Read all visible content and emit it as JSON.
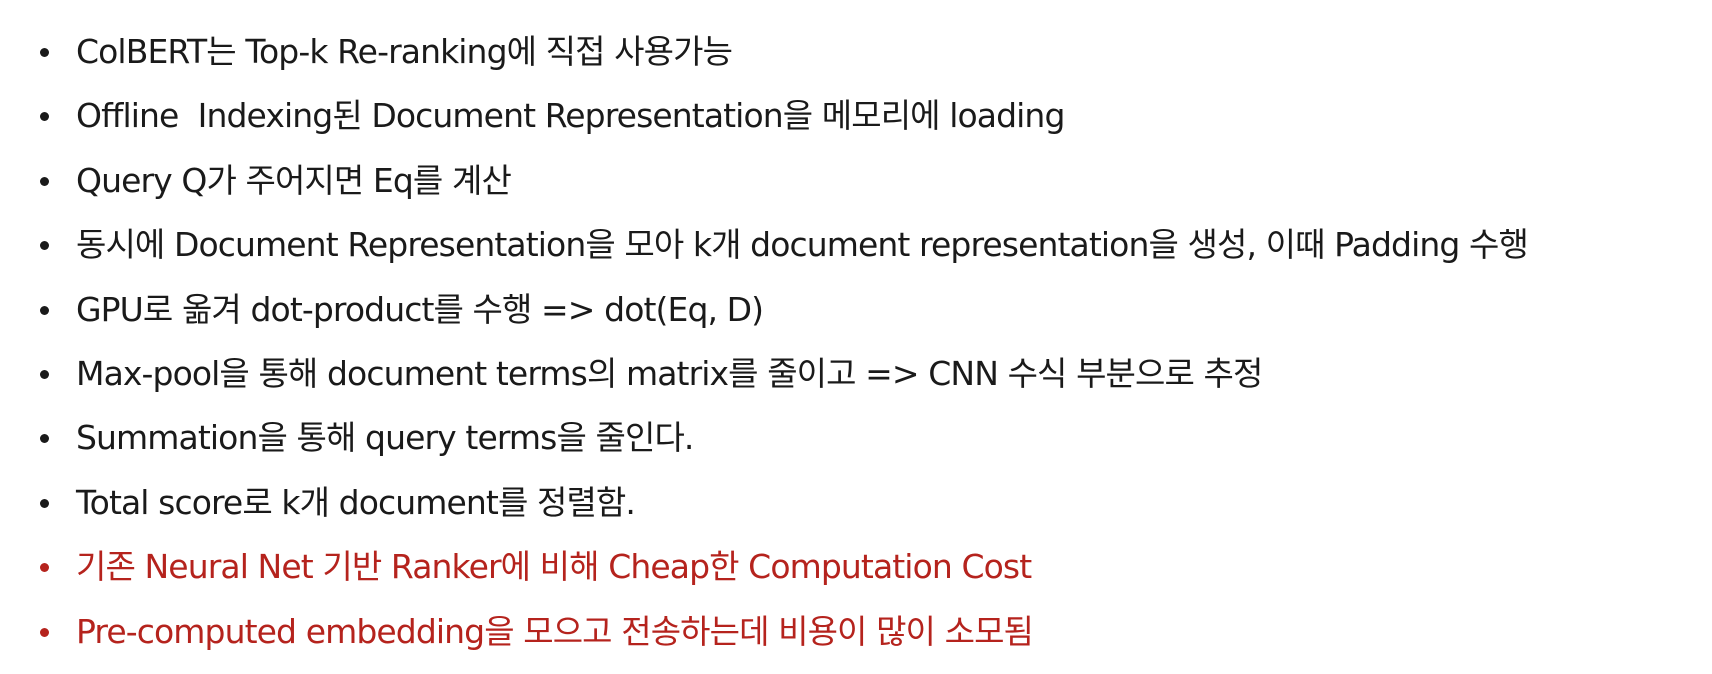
{
  "colors": {
    "text": "#1a1a1a",
    "highlight": "#b5231d",
    "background": "#ffffff"
  },
  "bullets": [
    {
      "text": "ColBERT는 Top-k Re-ranking에 직접 사용가능",
      "highlight": false
    },
    {
      "text": "Offline  Indexing된 Document Representation을 메모리에 loading",
      "highlight": false
    },
    {
      "text": "Query Q가 주어지면 Eq를 계산",
      "highlight": false
    },
    {
      "text": "동시에 Document Representation을 모아 k개 document representation을 생성, 이때 Padding 수행",
      "highlight": false
    },
    {
      "text": "GPU로 옮겨 dot-product를 수행 => dot(Eq, D)",
      "highlight": false
    },
    {
      "text": "Max-pool을 통해 document terms의 matrix를 줄이고 => CNN 수식 부분으로 추정",
      "highlight": false
    },
    {
      "text": "Summation을 통해 query terms을 줄인다.",
      "highlight": false
    },
    {
      "text": "Total score로 k개 document를 정렬함.",
      "highlight": false
    },
    {
      "text": "기존 Neural Net 기반 Ranker에 비해 Cheap한 Computation Cost",
      "highlight": true
    },
    {
      "text": "Pre-computed embedding을 모으고 전송하는데 비용이 많이 소모됨",
      "highlight": true
    }
  ]
}
